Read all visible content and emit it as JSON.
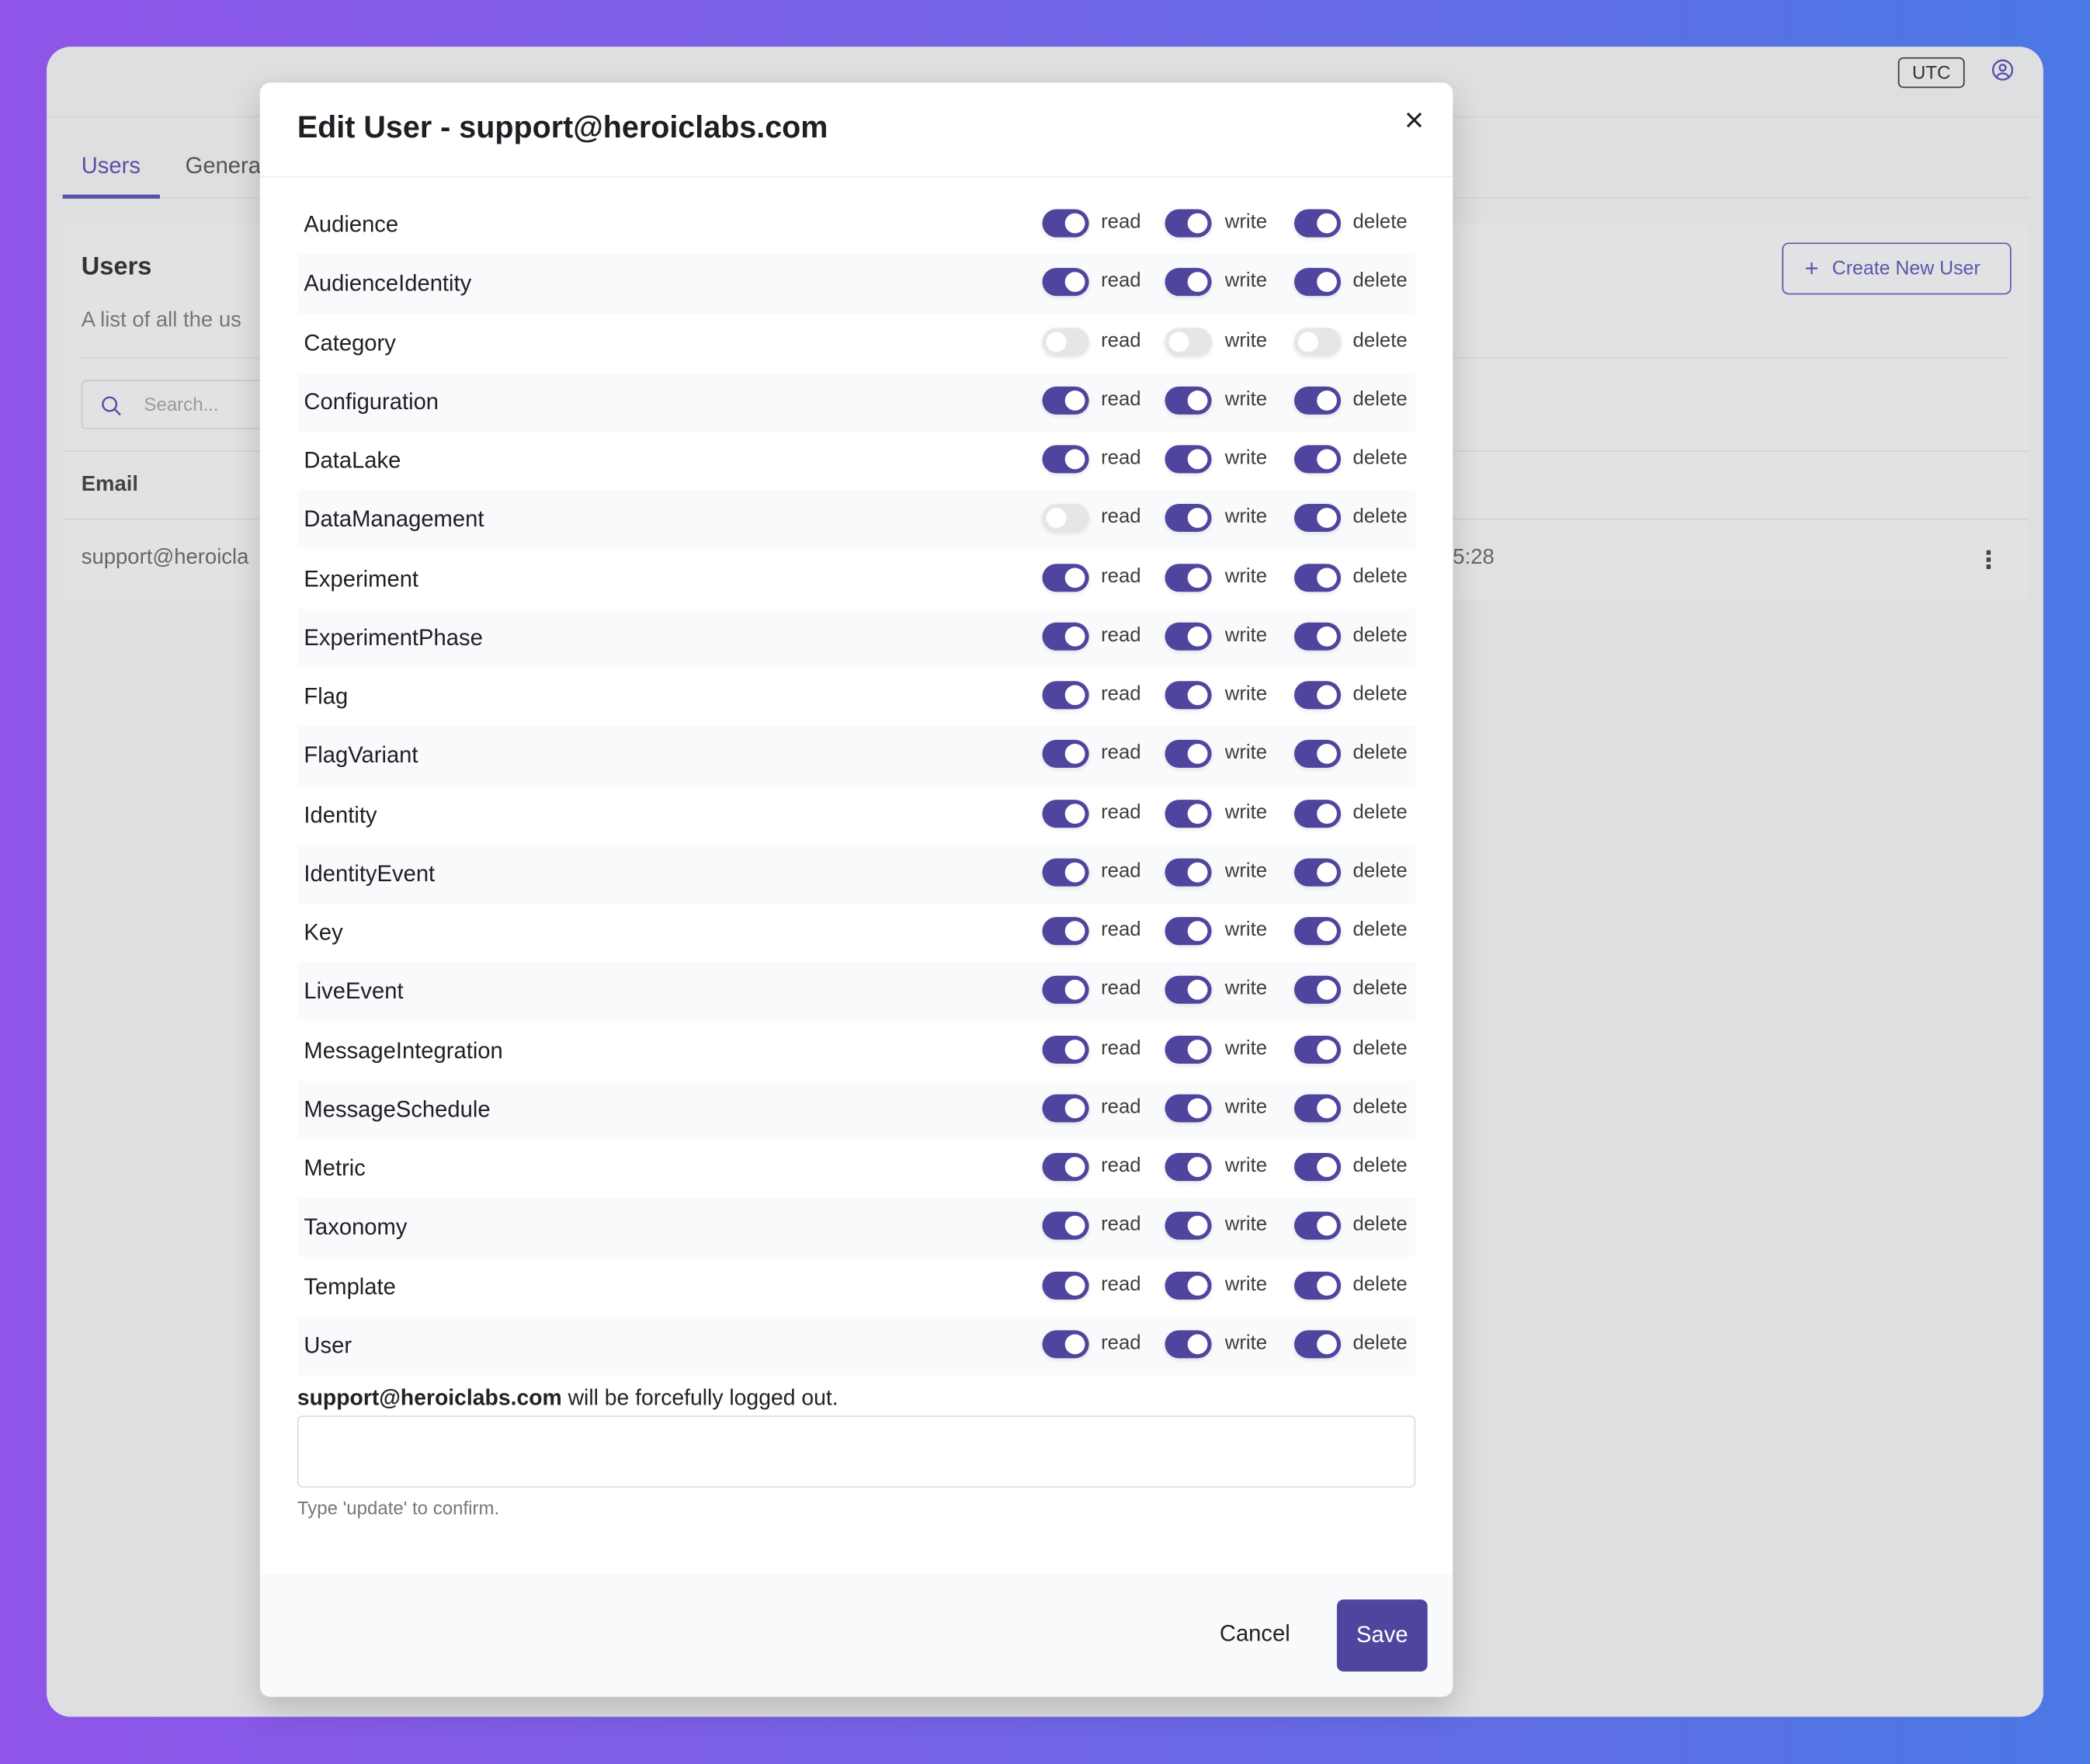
{
  "header": {
    "timezone": "UTC",
    "profile_icon": "user-circle-icon"
  },
  "tabs": [
    {
      "label": "Users",
      "active": true
    },
    {
      "label": "Genera"
    }
  ],
  "users_card": {
    "title": "Users",
    "subtitle": "A list of all the us",
    "search_placeholder": "Search...",
    "create_button": "Create New User",
    "column_email": "Email",
    "row": {
      "email": "support@heroicla",
      "time_fragment": "5:28"
    }
  },
  "colors": {
    "accent": "#4f459e",
    "toggle_off": "#e5e6e8"
  },
  "modal": {
    "title": "Edit User - support@heroiclabs.com",
    "perm_labels": {
      "read": "read",
      "write": "write",
      "delete": "delete"
    },
    "permissions": [
      {
        "name": "Audience",
        "read": true,
        "write": true,
        "delete": true
      },
      {
        "name": "AudienceIdentity",
        "read": true,
        "write": true,
        "delete": true
      },
      {
        "name": "Category",
        "read": false,
        "write": false,
        "delete": false
      },
      {
        "name": "Configuration",
        "read": true,
        "write": true,
        "delete": true
      },
      {
        "name": "DataLake",
        "read": true,
        "write": true,
        "delete": true
      },
      {
        "name": "DataManagement",
        "read": false,
        "write": true,
        "delete": true
      },
      {
        "name": "Experiment",
        "read": true,
        "write": true,
        "delete": true
      },
      {
        "name": "ExperimentPhase",
        "read": true,
        "write": true,
        "delete": true
      },
      {
        "name": "Flag",
        "read": true,
        "write": true,
        "delete": true
      },
      {
        "name": "FlagVariant",
        "read": true,
        "write": true,
        "delete": true
      },
      {
        "name": "Identity",
        "read": true,
        "write": true,
        "delete": true
      },
      {
        "name": "IdentityEvent",
        "read": true,
        "write": true,
        "delete": true
      },
      {
        "name": "Key",
        "read": true,
        "write": true,
        "delete": true
      },
      {
        "name": "LiveEvent",
        "read": true,
        "write": true,
        "delete": true
      },
      {
        "name": "MessageIntegration",
        "read": true,
        "write": true,
        "delete": true
      },
      {
        "name": "MessageSchedule",
        "read": true,
        "write": true,
        "delete": true
      },
      {
        "name": "Metric",
        "read": true,
        "write": true,
        "delete": true
      },
      {
        "name": "Taxonomy",
        "read": true,
        "write": true,
        "delete": true
      },
      {
        "name": "Template",
        "read": true,
        "write": true,
        "delete": true
      },
      {
        "name": "User",
        "read": true,
        "write": true,
        "delete": true
      }
    ],
    "warning_email": "support@heroiclabs.com",
    "warning_text": " will be forcefully logged out.",
    "confirm_value": "",
    "helper": "Type 'update' to confirm.",
    "cancel": "Cancel",
    "save": "Save"
  }
}
